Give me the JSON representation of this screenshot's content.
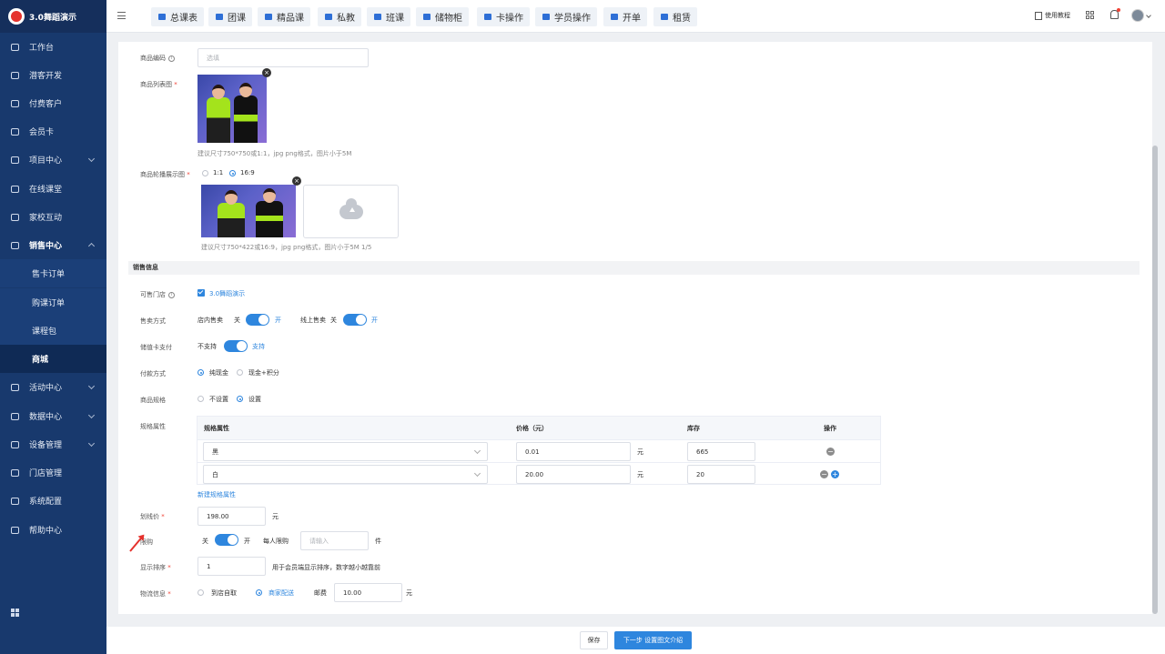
{
  "app": {
    "title": "3.0舞蹈演示",
    "brand_color": "#e5322d"
  },
  "sidebar": {
    "items": [
      {
        "label": "工作台",
        "icon": "dashboard-icon"
      },
      {
        "label": "潜客开发",
        "icon": "prospect-icon"
      },
      {
        "label": "付费客户",
        "icon": "customers-icon"
      },
      {
        "label": "会员卡",
        "icon": "card-icon"
      },
      {
        "label": "项目中心",
        "icon": "project-icon"
      },
      {
        "label": "在线课堂",
        "icon": "classroom-icon"
      },
      {
        "label": "家校互动",
        "icon": "interaction-icon"
      },
      {
        "label": "销售中心",
        "icon": "tag-icon"
      },
      {
        "label": "活动中心",
        "icon": "activity-icon"
      },
      {
        "label": "数据中心",
        "icon": "data-icon"
      },
      {
        "label": "设备管理",
        "icon": "device-icon"
      },
      {
        "label": "门店管理",
        "icon": "store-icon"
      },
      {
        "label": "系统配置",
        "icon": "settings-icon"
      },
      {
        "label": "帮助中心",
        "icon": "help-icon"
      }
    ],
    "sub_items": [
      {
        "label": "售卡订单"
      },
      {
        "label": "购课订单"
      },
      {
        "label": "课程包"
      },
      {
        "label": "商城",
        "active": true
      }
    ]
  },
  "topbar": {
    "tabs": [
      "总课表",
      "团课",
      "精品课",
      "私教",
      "班课",
      "储物柜",
      "卡操作",
      "学员操作",
      "开单",
      "租赁"
    ],
    "tutorial": "使用教程"
  },
  "form": {
    "code_label": "商品编码",
    "code_placeholder": "选填",
    "list_image_label": "商品列表图",
    "list_image_hint": "建议尺寸750*750或1:1，jpg png格式，图片小于5M",
    "carousel_label": "商品轮播展示图",
    "ratio_options": [
      "1:1",
      "16:9"
    ],
    "carousel_hint": "建议尺寸750*422或16:9，jpg png格式，图片小于5M 1/5",
    "section_title": "销售信息",
    "store_label": "可售门店",
    "store_value": "3.0舞蹈演示",
    "sale_mode_label": "售卖方式",
    "instore_label": "店内售卖",
    "online_label": "线上售卖",
    "off": "关",
    "on": "开",
    "stored_label": "储值卡支付",
    "stored_off": "不支持",
    "stored_on": "支持",
    "pay_label": "付款方式",
    "pay_options": [
      "纯现金",
      "现金+积分"
    ],
    "spec_label": "商品规格",
    "spec_options": [
      "不设置",
      "设置"
    ],
    "attr_label": "规格属性",
    "table": {
      "headers": [
        "规格属性",
        "价格（元）",
        "库存",
        "操作"
      ],
      "unit": "元",
      "rows": [
        {
          "attr": "黑",
          "price": "0.01",
          "stock": "665"
        },
        {
          "attr": "白",
          "price": "20.00",
          "stock": "20"
        }
      ]
    },
    "new_attr": "新建规格属性",
    "line_price_label": "划线价",
    "line_price": "198.00",
    "yuan": "元",
    "limit_label": "限购",
    "per_person_label": "每人限购",
    "per_person_placeholder": "请输入",
    "piece": "件",
    "sort_label": "显示排序",
    "sort_value": "1",
    "sort_hint": "用于会员端显示排序，数字越小越靠前",
    "logistics_label": "物流信息",
    "logistics_options": [
      "到店自取",
      "商家配送"
    ],
    "postage_label": "邮费",
    "postage_value": "10.00"
  },
  "footer": {
    "save": "保存",
    "next": "下一步 设置图文介绍"
  },
  "colors": {
    "sidebar_bg": "#18396d",
    "accent": "#2e86de"
  }
}
